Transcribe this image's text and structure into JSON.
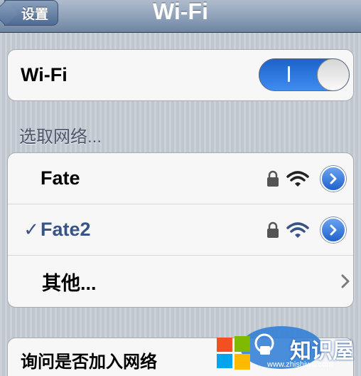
{
  "navbar": {
    "back_label": "设置",
    "title": "Wi-Fi"
  },
  "wifi": {
    "label": "Wi-Fi",
    "toggle_on": true
  },
  "section_header": "选取网络...",
  "networks": [
    {
      "name": "Fate",
      "check": "",
      "secured": true
    },
    {
      "name": "Fate2",
      "check": "✓",
      "secured": true
    },
    {
      "name": "其他..."
    }
  ],
  "ask_join": {
    "label": "询问是否加入网络"
  },
  "watermark": {
    "text": "知识屋",
    "url": "www.zhishiwu.com"
  },
  "colors": {
    "accent": "#1f62cc",
    "selected_text": "#385487"
  }
}
